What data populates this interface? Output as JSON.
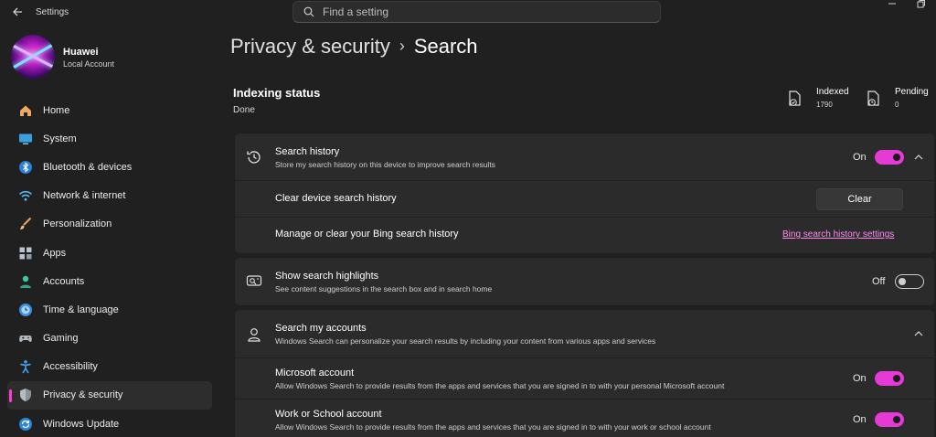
{
  "window": {
    "title": "Settings",
    "back_icon": "back-arrow-icon",
    "controls": [
      "minimize",
      "maximize"
    ]
  },
  "search": {
    "placeholder": "Find a setting",
    "icon": "search-icon"
  },
  "profile": {
    "name": "Huawei",
    "account_type": "Local Account"
  },
  "sidebar": {
    "items": [
      {
        "label": "Home",
        "icon": "home-icon"
      },
      {
        "label": "System",
        "icon": "monitor-icon"
      },
      {
        "label": "Bluetooth & devices",
        "icon": "bluetooth-icon"
      },
      {
        "label": "Network & internet",
        "icon": "wifi-icon"
      },
      {
        "label": "Personalization",
        "icon": "brush-icon"
      },
      {
        "label": "Apps",
        "icon": "apps-icon"
      },
      {
        "label": "Accounts",
        "icon": "person-icon"
      },
      {
        "label": "Time & language",
        "icon": "globe-clock-icon"
      },
      {
        "label": "Gaming",
        "icon": "gamepad-icon"
      },
      {
        "label": "Accessibility",
        "icon": "accessibility-icon"
      },
      {
        "label": "Privacy & security",
        "icon": "shield-icon",
        "active": true
      },
      {
        "label": "Windows Update",
        "icon": "update-icon"
      }
    ],
    "accent_color": "#ff3bd4"
  },
  "breadcrumb": {
    "parent": "Privacy & security",
    "separator": "›",
    "current": "Search"
  },
  "indexing": {
    "title": "Indexing status",
    "status": "Done",
    "indexed_label": "Indexed",
    "indexed_value": "1790",
    "pending_label": "Pending",
    "pending_value": "0"
  },
  "search_history": {
    "title": "Search history",
    "description": "Store my search history on this device to improve search results",
    "state": "On",
    "enabled": true,
    "clear_row": {
      "label": "Clear device search history",
      "button": "Clear"
    },
    "bing_row": {
      "label": "Manage or clear your Bing search history",
      "link": "Bing search history settings"
    }
  },
  "highlights": {
    "title": "Show search highlights",
    "description": "See content suggestions in the search box and in search home",
    "state": "Off",
    "enabled": false
  },
  "accounts": {
    "title": "Search my accounts",
    "description": "Windows Search can personalize your search results by including your content from various apps and services",
    "microsoft": {
      "title": "Microsoft account",
      "description": "Allow Windows Search to provide results from the apps and services that you are signed in to with your personal Microsoft account",
      "state": "On",
      "enabled": true
    },
    "work": {
      "title": "Work or School account",
      "description": "Allow Windows Search to provide results from the apps and services that you are signed in to with your work or school account",
      "state": "On",
      "enabled": true
    }
  },
  "colors": {
    "toggle_on": "#e63ad6",
    "link": "#ff8bf0",
    "background": "#202020",
    "card": "#2b2b2b"
  }
}
